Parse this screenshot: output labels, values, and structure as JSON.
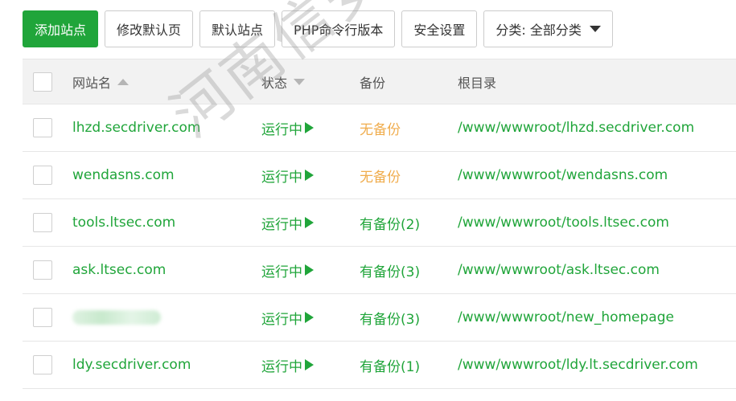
{
  "toolbar": {
    "add_site": "添加站点",
    "edit_default_page": "修改默认页",
    "default_site": "默认站点",
    "php_cli_version": "PHP命令行版本",
    "security_settings": "安全设置",
    "category_select": "分类: 全部分类"
  },
  "table": {
    "columns": {
      "name": "网站名",
      "status": "状态",
      "backup": "备份",
      "root": "根目录"
    },
    "rows": [
      {
        "name": "lhzd.secdriver.com",
        "status": "运行中",
        "backup": "无备份",
        "root": "/www/wwwroot/lhzd.secdriver.com"
      },
      {
        "name": "wendasns.com",
        "status": "运行中",
        "backup": "无备份",
        "root": "/www/wwwroot/wendasns.com"
      },
      {
        "name": "tools.ltsec.com",
        "status": "运行中",
        "backup": "有备份(2)",
        "root": "/www/wwwroot/tools.ltsec.com"
      },
      {
        "name": "ask.ltsec.com",
        "status": "运行中",
        "backup": "有备份(3)",
        "root": "/www/wwwroot/ask.ltsec.com"
      },
      {
        "name": "",
        "status": "运行中",
        "backup": "有备份(3)",
        "root": "/www/wwwroot/new_homepage"
      },
      {
        "name": "ldy.secdriver.com",
        "status": "运行中",
        "backup": "有备份(1)",
        "root": "/www/wwwroot/ldy.lt.secdriver.com"
      }
    ]
  },
  "watermark": "河南信安世纪科技",
  "colors": {
    "accent_green": "#20a53a",
    "no_backup_orange": "#f0ad4e"
  }
}
